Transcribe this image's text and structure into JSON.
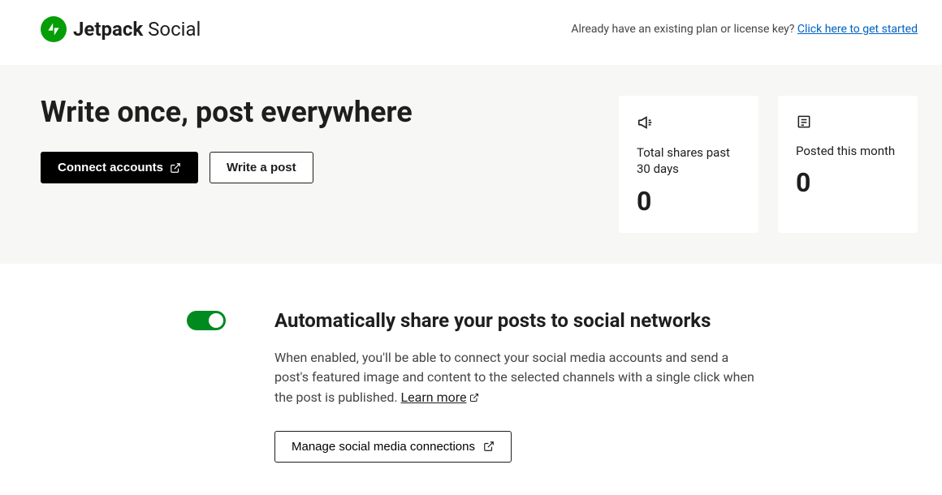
{
  "header": {
    "brand_bold": "Jetpack",
    "brand_light": "Social",
    "prompt": "Already have an existing plan or license key? ",
    "link": "Click here to get started"
  },
  "hero": {
    "title": "Write once, post everywhere",
    "connect_label": "Connect accounts",
    "write_label": "Write a post",
    "stats": [
      {
        "label": "Total shares past 30 days",
        "value": "0"
      },
      {
        "label": "Posted this month",
        "value": "0"
      }
    ]
  },
  "autoshare": {
    "enabled": true,
    "title": "Automatically share your posts to social networks",
    "body": "When enabled, you'll be able to connect your social media accounts and send a post's featured image and content to the selected channels with a single click when the post is published. ",
    "learn_more": "Learn more",
    "manage_label": "Manage social media connections"
  }
}
